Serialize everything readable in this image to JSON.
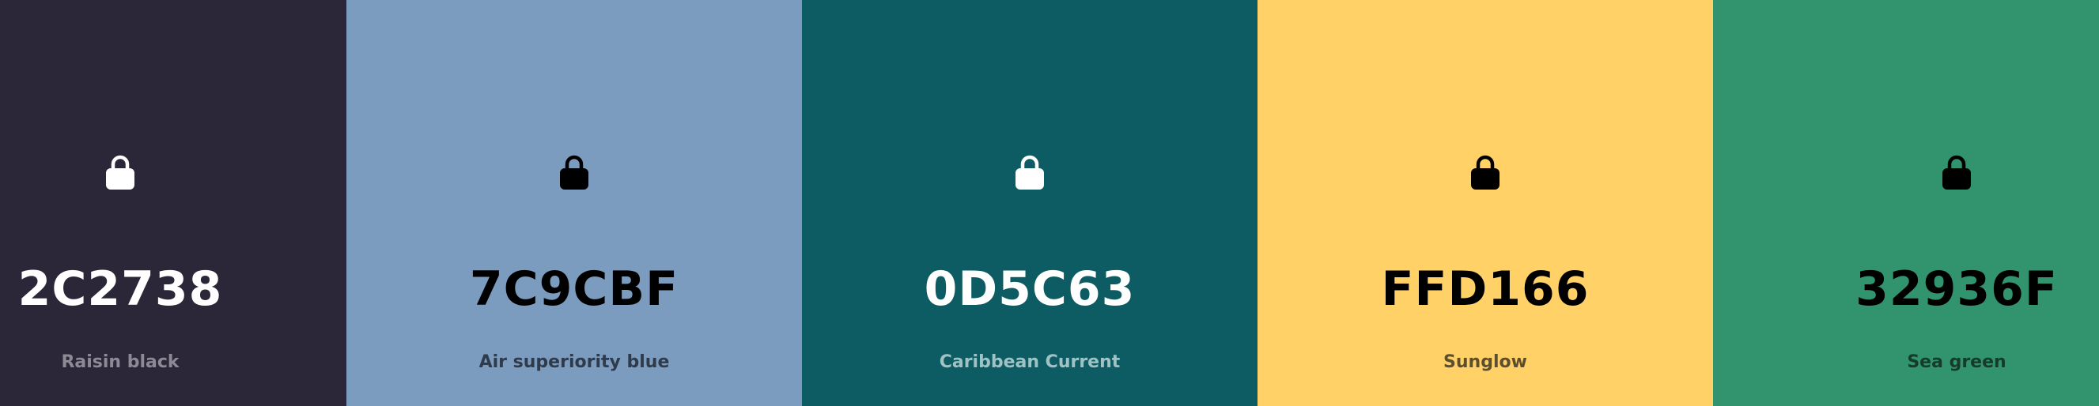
{
  "palette": {
    "swatches": [
      {
        "hex": "2C2738",
        "name": "Raisin black",
        "color": "#2C2738",
        "text_color": "#FFFFFF",
        "lock_icon": "lock-icon",
        "locked": true
      },
      {
        "hex": "7C9CBF",
        "name": "Air superiority blue",
        "color": "#7C9CBF",
        "text_color": "#000000",
        "lock_icon": "lock-icon",
        "locked": true
      },
      {
        "hex": "0D5C63",
        "name": "Caribbean Current",
        "color": "#0D5C63",
        "text_color": "#FFFFFF",
        "lock_icon": "lock-icon",
        "locked": true
      },
      {
        "hex": "FFD166",
        "name": "Sunglow",
        "color": "#FFD166",
        "text_color": "#000000",
        "lock_icon": "lock-icon",
        "locked": true
      },
      {
        "hex": "32936F",
        "name": "Sea green",
        "color": "#32936F",
        "text_color": "#000000",
        "lock_icon": "lock-icon",
        "locked": true
      }
    ]
  }
}
